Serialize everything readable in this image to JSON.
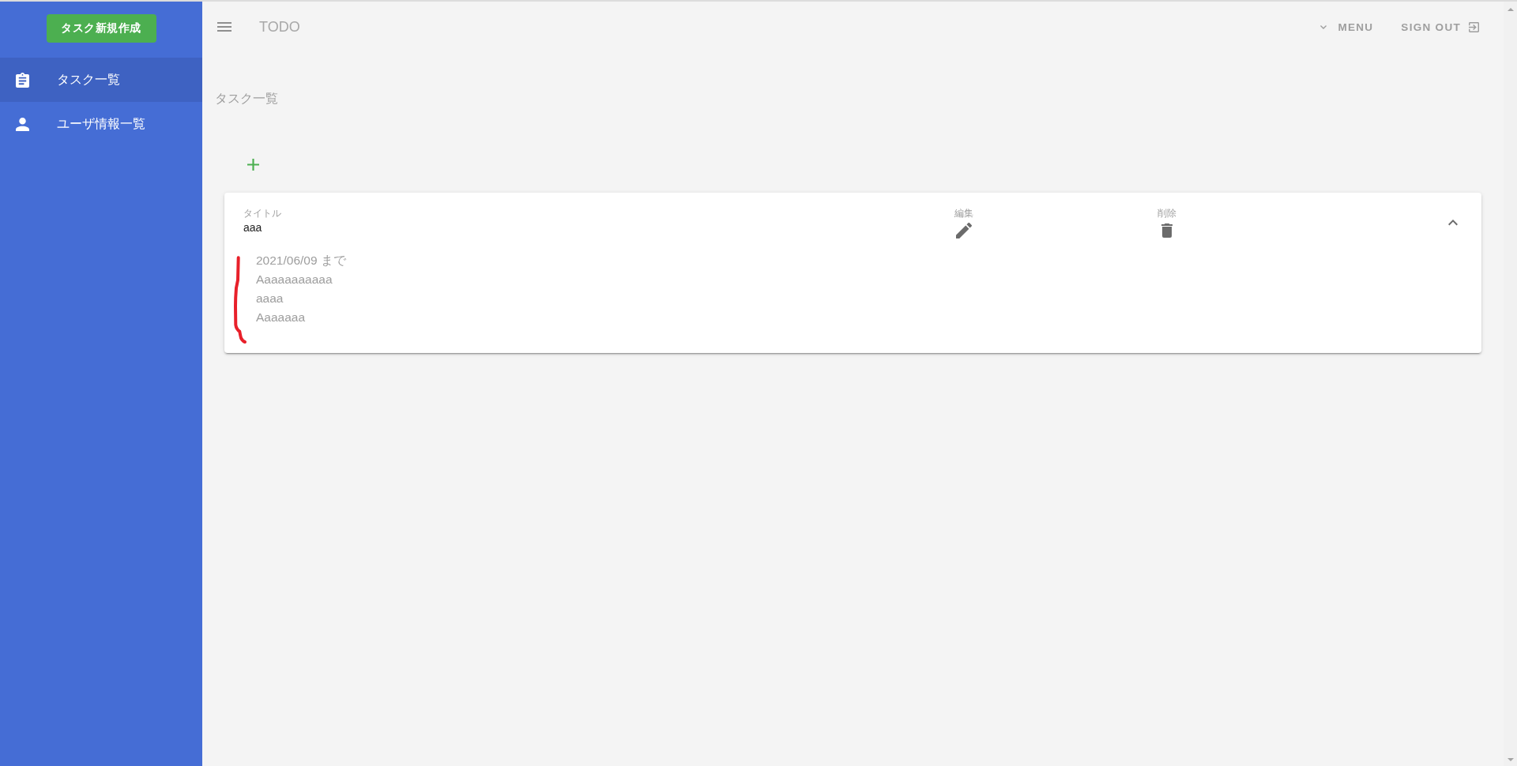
{
  "sidebar": {
    "create_button": "タスク新規作成",
    "items": [
      {
        "kind": "tasks",
        "label": "タスク一覧",
        "selected": true
      },
      {
        "kind": "users",
        "label": "ユーザ情報一覧",
        "selected": false
      }
    ]
  },
  "app_bar": {
    "title": "TODO",
    "menu": "MENU",
    "sign_out": "SIGN OUT"
  },
  "page_title": "タスク一覧",
  "tasks": [
    {
      "title_label": "タイトル",
      "title": "aaa",
      "edit_label": "編集",
      "delete_label": "削除",
      "expanded": true,
      "due": "2021/06/09 まで",
      "details": [
        "Aaaaaaaaaaa",
        "aaaa",
        "Aaaaaaa"
      ]
    }
  ]
}
